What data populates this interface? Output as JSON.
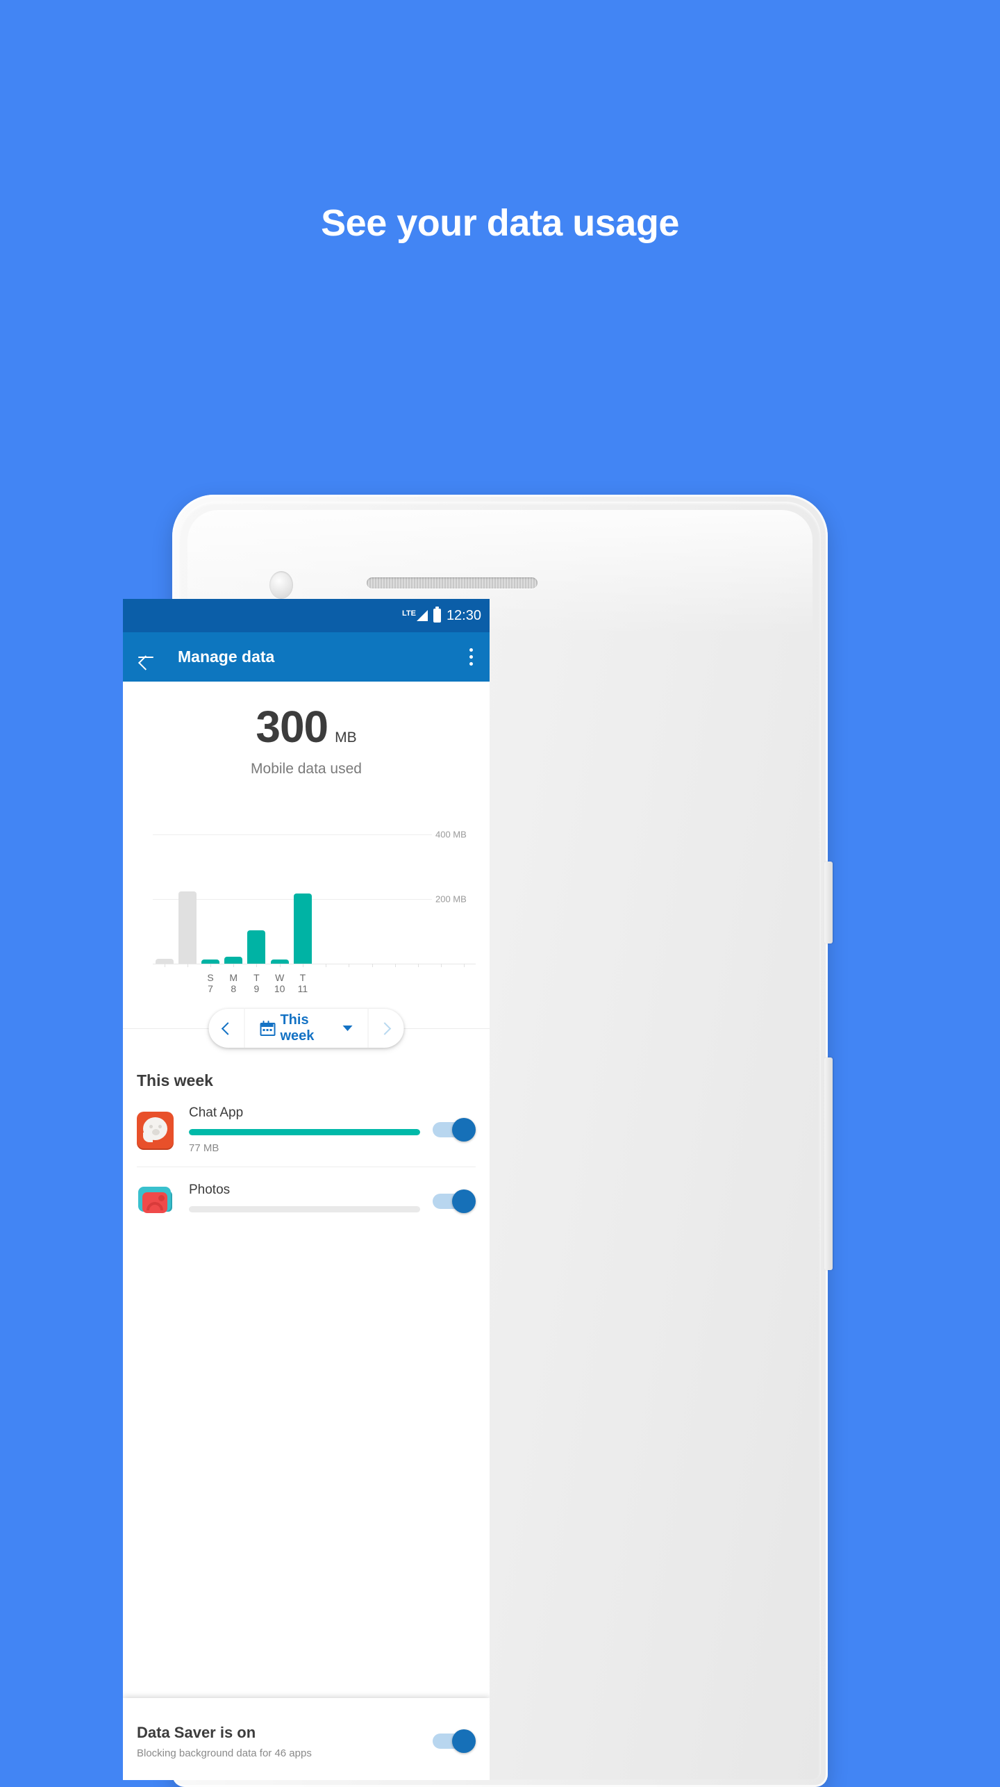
{
  "promo": {
    "headline": "See your data usage",
    "background_color": "#4285f4"
  },
  "phone": {
    "frame_color": "#f2f2f2",
    "buttons": [
      "power-button",
      "volume-rocker"
    ]
  },
  "status_bar": {
    "network_label": "LTE",
    "time": "12:30",
    "background_color": "#0b5ea8",
    "icons": [
      "signal-icon",
      "battery-icon"
    ]
  },
  "app_bar": {
    "title": "Manage data",
    "background_color": "#0d76bf",
    "back_label": "Back",
    "overflow_label": "More options"
  },
  "usage_summary": {
    "amount": "300",
    "unit": "MB",
    "caption": "Mobile data used"
  },
  "chart_data": {
    "type": "bar",
    "title": "Mobile data used",
    "xlabel": "",
    "ylabel": "MB",
    "ylim": [
      0,
      480
    ],
    "grid": true,
    "gridlines": [
      {
        "value": 400,
        "label": "400 MB"
      },
      {
        "value": 200,
        "label": "200 MB"
      }
    ],
    "legend": [],
    "bars": [
      {
        "label": "",
        "sublabel": "",
        "value": 14,
        "color": "#e0e0e0",
        "series": "previous"
      },
      {
        "label": "",
        "sublabel": "",
        "value": 222,
        "color": "#e0e0e0",
        "series": "previous"
      },
      {
        "label": "S",
        "sublabel": "7",
        "value": 11,
        "color": "#00b3a4",
        "series": "this-week"
      },
      {
        "label": "M",
        "sublabel": "8",
        "value": 22,
        "color": "#00b3a4",
        "series": "this-week"
      },
      {
        "label": "T",
        "sublabel": "9",
        "value": 103,
        "color": "#00b3a4",
        "series": "this-week"
      },
      {
        "label": "W",
        "sublabel": "10",
        "value": 13,
        "color": "#00b3a4",
        "series": "this-week"
      },
      {
        "label": "T",
        "sublabel": "11",
        "value": 215,
        "color": "#00b3a4",
        "series": "this-week"
      }
    ],
    "categories": [
      "",
      "",
      "S 7",
      "M 8",
      "T 9",
      "W 10",
      "T 11"
    ],
    "values": [
      14,
      222,
      11,
      22,
      103,
      13,
      215
    ]
  },
  "date_selector": {
    "prev_label": "Previous period",
    "next_label": "Next period",
    "current": "This week",
    "calendar_icon": "calendar-icon",
    "dropdown_icon": "chevron-down-icon",
    "accent_color": "#1472c4",
    "next_disabled_color": "#b9d9f0"
  },
  "app_list": {
    "heading": "This week",
    "items": [
      {
        "name": "Chat App",
        "size": "77 MB",
        "progress_percent": 100,
        "icon": "chat-app-icon",
        "toggle_on": true
      },
      {
        "name": "Photos",
        "size": "",
        "progress_percent": 0,
        "icon": "photos-app-icon",
        "toggle_on": true
      }
    ],
    "bar_color": "#00b9a8",
    "toggle_color": "#1670b8"
  },
  "bottom_sheet": {
    "title": "Data Saver is on",
    "subtitle": "Blocking background data for 46 apps",
    "toggle_on": true
  }
}
